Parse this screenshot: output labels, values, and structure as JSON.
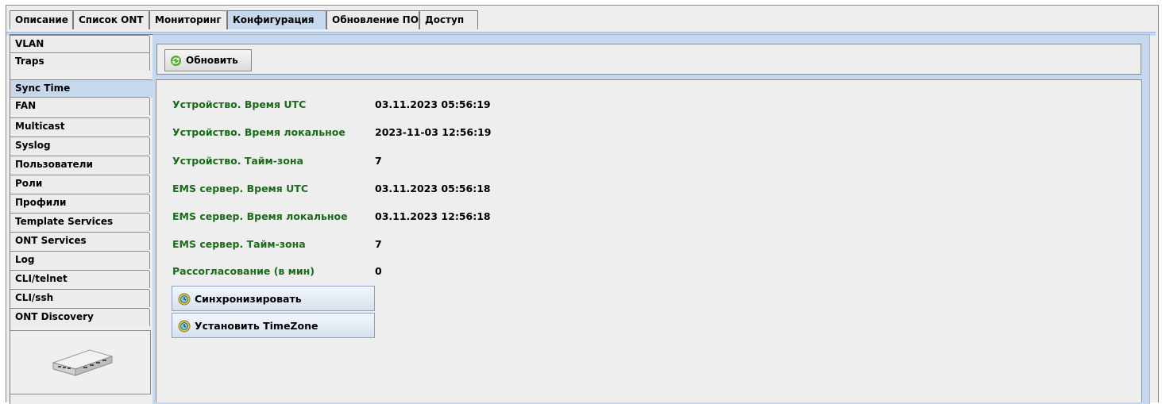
{
  "top_tabs": [
    "Описание",
    "Список ONT",
    "Мониторинг",
    "Конфигурация",
    "Обновление ПО",
    "Доступ"
  ],
  "active_top_tab": "Конфигурация",
  "left_menu": [
    "VLAN",
    "Traps",
    "Sync Time",
    "FAN",
    "Multicast",
    "Syslog",
    "Пользователи",
    "Роли",
    "Профили",
    "Template Services",
    "ONT Services",
    "Log",
    "CLI/telnet",
    "CLI/ssh",
    "ONT Discovery"
  ],
  "active_left_item": "Sync Time",
  "toolbar": {
    "refresh_label": "Обновить"
  },
  "rows": [
    {
      "label": "Устройство. Время UTC",
      "value": "03.11.2023 05:56:19"
    },
    {
      "label": "Устройство. Время локальное",
      "value": "2023-11-03 12:56:19"
    },
    {
      "label": "Устройство. Тайм-зона",
      "value": "7"
    },
    {
      "label": "EMS сервер. Время UTC",
      "value": "03.11.2023 05:56:18"
    },
    {
      "label": "EMS сервер. Время локальное",
      "value": "03.11.2023 12:56:18"
    },
    {
      "label": "EMS сервер. Тайм-зона",
      "value": "7"
    },
    {
      "label": "Рассогласование (в мин)",
      "value": "0"
    }
  ],
  "actions": {
    "sync_label": "Синхронизировать",
    "set_timezone_label": "Установить TimeZone"
  },
  "colors": {
    "accent": "#c6d8ee",
    "label_green": "#1b6b1b"
  }
}
